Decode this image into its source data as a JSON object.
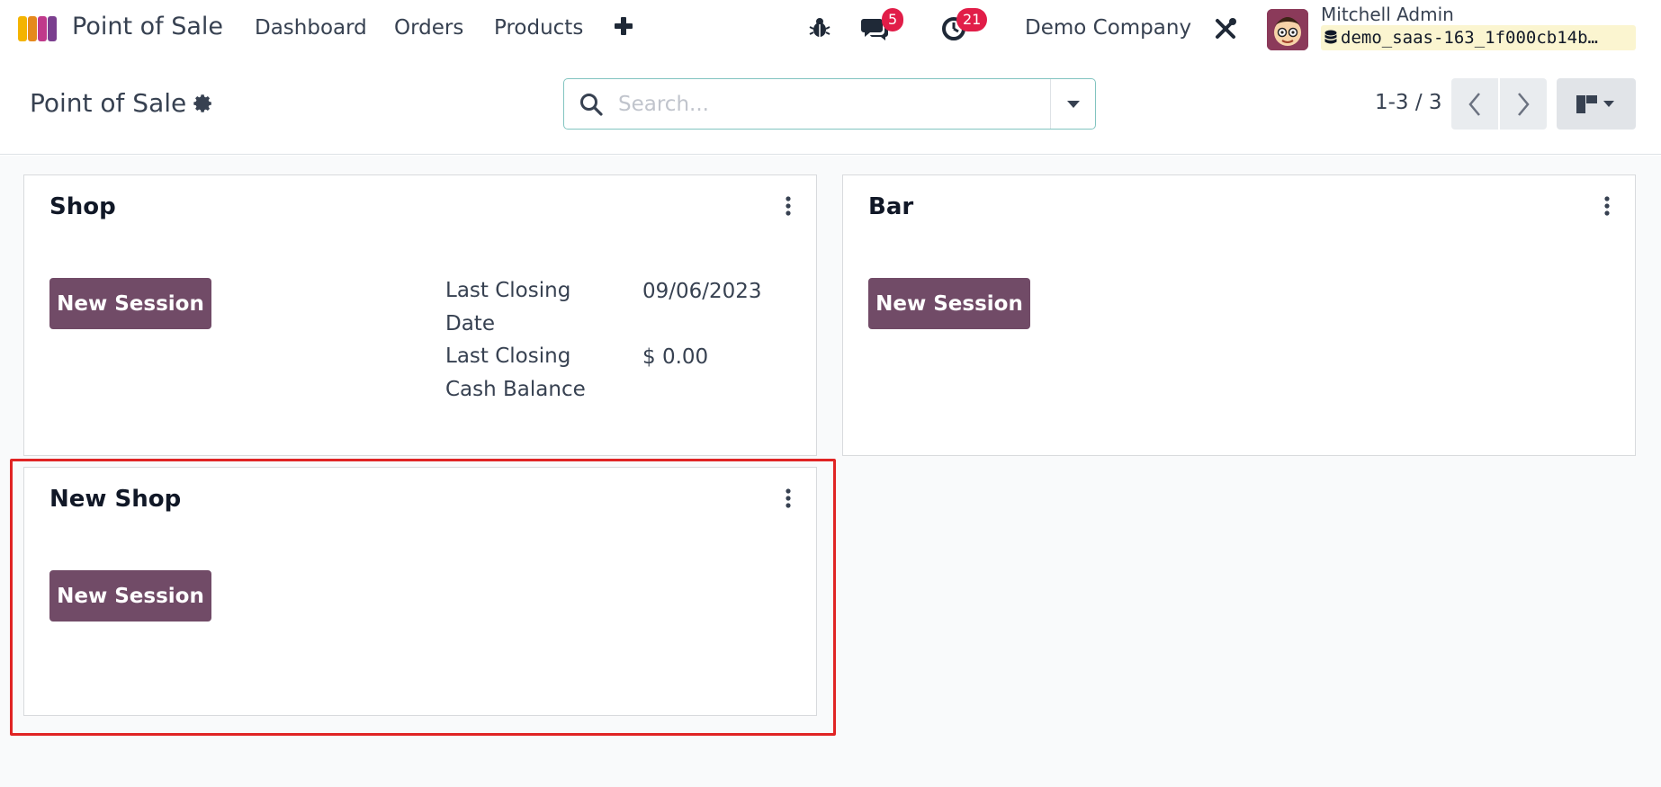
{
  "navbar": {
    "app_name": "Point of Sale",
    "menu": [
      "Dashboard",
      "Orders",
      "Products"
    ],
    "messages_count": "5",
    "activities_count": "21",
    "company": "Demo Company",
    "user_name": "Mitchell Admin",
    "database": "demo_saas-163_1f000cb14b…",
    "icons": [
      "app-logo-icon",
      "plus-icon",
      "bug-icon",
      "chat-icon",
      "clock-icon",
      "tools-icon",
      "database-icon"
    ]
  },
  "control_panel": {
    "title": "Point of Sale",
    "search_placeholder": "Search...",
    "pager": "1-3 / 3"
  },
  "cards": [
    {
      "title": "Shop",
      "button": "New Session",
      "info": [
        {
          "label": "Last Closing Date",
          "value": "09/06/2023"
        },
        {
          "label": "Last Closing Cash Balance",
          "value": "$ 0.00"
        }
      ]
    },
    {
      "title": "Bar",
      "button": "New Session"
    },
    {
      "title": "New Shop",
      "button": "New Session"
    }
  ],
  "colors": {
    "primary": "#714b67",
    "badge": "#e11d48",
    "highlight": "#e02424",
    "db_chip": "#fbf5d0"
  }
}
